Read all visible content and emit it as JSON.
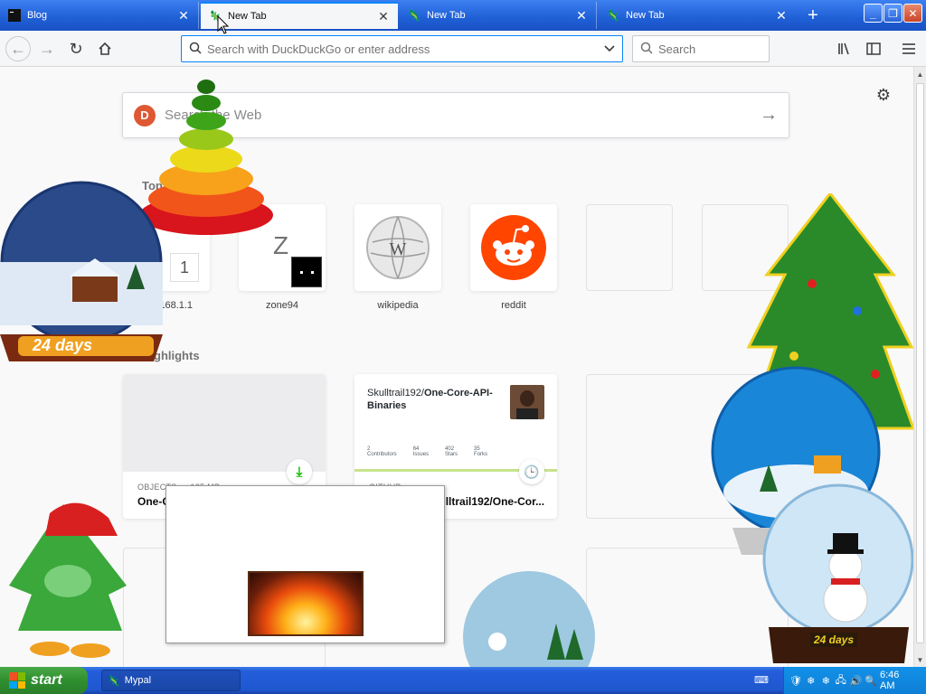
{
  "tabs": [
    {
      "label": "Blog",
      "active": false
    },
    {
      "label": "New Tab",
      "active": true
    },
    {
      "label": "New Tab",
      "active": false
    },
    {
      "label": "New Tab",
      "active": false
    }
  ],
  "window_controls": {
    "minimize": "_",
    "restore": "❐",
    "close": "✕"
  },
  "navbar": {
    "url_placeholder": "Search with DuckDuckGo or enter address",
    "search_placeholder": "Search"
  },
  "newtab": {
    "web_search_placeholder": "Search the Web",
    "top_sites_title": "Top Sites",
    "top_sites": [
      {
        "name": "192.168.1.1",
        "letter": "1"
      },
      {
        "name": "zone94",
        "letter": "Z"
      },
      {
        "name": "wikipedia",
        "letter": ""
      },
      {
        "name": "reddit",
        "letter": ""
      },
      {
        "name": "",
        "letter": ""
      },
      {
        "name": "",
        "letter": ""
      }
    ],
    "highlights_title": "Highlights",
    "highlights": [
      {
        "context": "OBJECTS — 135 MB",
        "title": "One-Core-API-Binaries-3.0.3.zip"
      },
      {
        "context": "GITHUB",
        "title": "Releases · Skulltrail192/One-Cor...",
        "repo_owner": "Skulltrail192/",
        "repo_name": "One-Core-API-Binaries",
        "stats": [
          {
            "value": "2",
            "label": "Contributors"
          },
          {
            "value": "64",
            "label": "Issues"
          },
          {
            "value": "402",
            "label": "Stars"
          },
          {
            "value": "35",
            "label": "Forks"
          }
        ]
      }
    ]
  },
  "decorations": {
    "globe_banner_1": "24 days",
    "globe_banner_2": "24 days"
  },
  "taskbar": {
    "start_label": "start",
    "task_label": "Mypal",
    "clock": "6:46 AM"
  },
  "colors": {
    "accent": "#0a84ff",
    "taskbar": "#245edb",
    "start": "#2f8f2f",
    "reddit": "#ff4500",
    "duckduckgo": "#de5833"
  }
}
